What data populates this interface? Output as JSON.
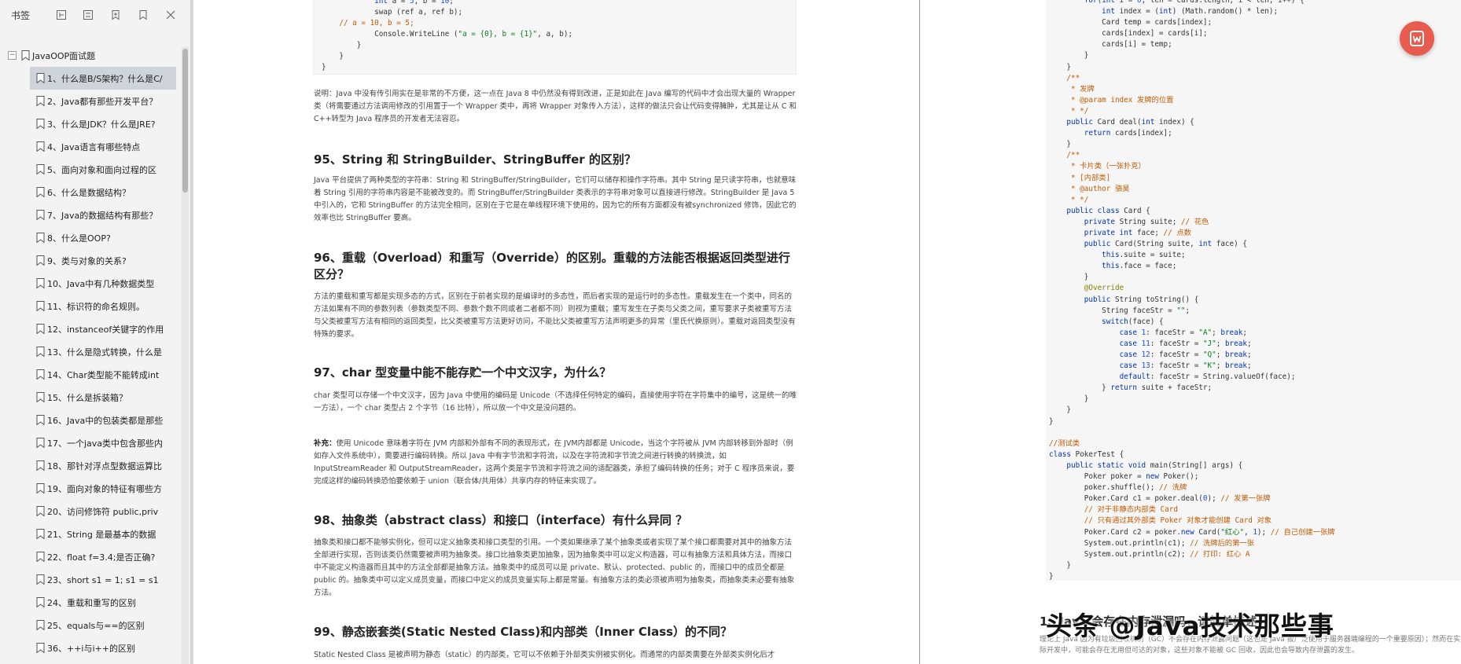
{
  "sidebar": {
    "title": "书签",
    "tools": [
      "expand-all-icon",
      "collapse-all-icon",
      "add-bookmark-icon",
      "bookmark-outline-icon",
      "close-icon"
    ],
    "root": {
      "toggle": "−",
      "label": "JavaOOP面试题"
    },
    "items": [
      "1、什么是B/S架构？什么是C/",
      "2、Java都有那些开发平台？",
      "3、什么是JDK？什么是JRE?",
      "4、Java语言有哪些特点",
      "5、面向对象和面向过程的区",
      "6、什么是数据结构？",
      "7、Java的数据结构有那些？",
      "8、什么是OOP?",
      "9、类与对象的关系?",
      "10、Java中有几种数据类型",
      "11、标识符的命名规则。",
      "12、instanceof关键字的作用",
      "13、什么是隐式转换，什么是",
      "14、Char类型能不能转成int",
      "15、什么是拆装箱？",
      "16、Java中的包装类都是那些",
      "17、一个java类中包含那些内",
      "18、那针对浮点型数据运算比",
      "19、面向对象的特征有哪些方",
      "20、访问修饰符 public,priv",
      "21、String 是最基本的数据",
      "22、float f=3.4;是否正确?",
      "23、short s1 = 1; s1 = s1",
      "24、重载和重写的区别",
      "25、equals与==的区别",
      "36、++i与i++的区别"
    ]
  },
  "page1": {
    "code_lines": [
      [
        "            ",
        "kw:int",
        " a = ",
        "num:5",
        ", b = ",
        "num:10",
        ";"
      ],
      [
        "            swap (ref a, ref b);"
      ],
      [
        "cm:    // a = 10, b = 5;"
      ],
      [
        "            Console.WriteLine (",
        "str:\"a = {0}, b = {1}\"",
        ", a, b);"
      ],
      [
        "        }"
      ],
      [
        "    }"
      ],
      [
        "}"
      ]
    ],
    "note": "说明：Java 中没有传引用实在是非常的不方便，这一点在 Java 8 中仍然没有得到改进，正是如此在 Java 编写的代码中才会出现大量的 Wrapper 类（将需要通过方法调用修改的引用置于一个 Wrapper 类中，再将 Wrapper 对象传入方法），这样的做法只会让代码变得臃肿，尤其是让从 C 和 C++转型为 Java 程序员的开发者无法容忍。",
    "h95": "95、String 和 StringBuilder、StringBuffer 的区别？",
    "p95": "Java 平台提供了两种类型的字符串：String 和 StringBuffer/StringBuilder，它们可以储存和操作字符串。其中 String 是只读字符串，也就意味着 String 引用的字符串内容是不能被改变的。而 StringBuffer/StringBuilder 类表示的字符串对象可以直接进行修改。StringBuilder 是 Java 5 中引入的，它和 StringBuffer 的方法完全相同，区别在于它是在单线程环境下使用的，因为它的所有方面都没有被synchronized 修饰，因此它的效率也比 StringBuffer 要高。",
    "h96": "96、重载（Overload）和重写（Override）的区别。重载的方法能否根据返回类型进行区分？",
    "p96": "方法的重载和重写都是实现多态的方式，区别在于前者实现的是编译时的多态性，而后者实现的是运行时的多态性。重载发生在一个类中，同名的方法如果有不同的参数列表（参数类型不同、参数个数不同或者二者都不同）则视为重载；重写发生在子类与父类之间，重写要求子类被重写方法与父类被重写方法有相同的返回类型，比父类被重写方法更好访问，不能比父类被重写方法声明更多的异常（里氏代换原则）。重载对返回类型没有特殊的要求。",
    "h97": "97、char 型变量中能不能存贮一个中文汉字，为什么？",
    "p97": "char 类型可以存储一个中文汉字，因为 Java 中使用的编码是 Unicode（不选择任何特定的编码，直接使用字符在字符集中的编号，这是统一的唯一方法），一个 char 类型占 2 个字节（16 比特），所以放一个中文是没问题的。",
    "p97b_label": "补充：",
    "p97b": "使用 Unicode 意味着字符在 JVM 内部和外部有不同的表现形式，在 JVM内部都是 Unicode，当这个字符被从 JVM 内部转移到外部时（例如存入文件系统中），需要进行编码转换。所以 Java 中有字节流和字符流，以及在字符流和字节流之间进行转换的转换流，如 InputStreamReader 和 OutputStreamReader，这两个类是字节流和字符流之间的适配器类，承担了编码转换的任务；对于 C 程序员来说，要完成这样的编码转换恐怕要依赖于 union（联合体/共用体）共享内存的特征来实现了。",
    "h98": "98、抽象类（abstract class）和接口（interface）有什么异同 ？",
    "p98": "抽象类和接口都不能够实例化，但可以定义抽象类和接口类型的引用。一个类如果继承了某个抽象类或者实现了某个接口都需要对其中的抽象方法全部进行实现，否则该类仍然需要被声明为抽象类。接口比抽象类更加抽象，因为抽象类中可以定义构造器，可以有抽象方法和具体方法，而接口中不能定义构造器而且其中的方法全部都是抽象方法。抽象类中的成员可以是 private、默认、protected、public 的，而接口中的成员全都是 public 的。抽象类中可以定义成员变量，而接口中定义的成员变量实际上都是常量。有抽象方法的类必须被声明为抽象类，而抽象类未必要有抽象方法。",
    "h99": "99、静态嵌套类(Static Nested Class)和内部类（Inner Class）的不同？",
    "p99": "Static Nested Class 是被声明为静态（static）的内部类，它可以不依赖于外部类实例被实例化。而通常的内部类需要在外部类实例化后才"
  },
  "page2": {
    "code_lines": [
      [
        "        ",
        "kw:for",
        "(",
        "kw:int",
        " i = ",
        "num:0",
        ", len = cards.length; i < len; i++) {"
      ],
      [
        "            ",
        "kw:int",
        " index = (",
        "kw:int",
        ") (Math.random() * len);"
      ],
      [
        "            Card temp = cards[index];"
      ],
      [
        "            cards[index] = cards[i];"
      ],
      [
        "            cards[i] = temp;"
      ],
      [
        "        }"
      ],
      [
        "    }"
      ],
      [
        "cm:    /**"
      ],
      [
        "cm:     * 发牌"
      ],
      [
        "cm:     * @param index 发牌的位置"
      ],
      [
        "cm:     * */"
      ],
      [
        "    ",
        "kw:public",
        " Card deal(",
        "kw:int",
        " index) {"
      ],
      [
        "        ",
        "kw:return",
        " cards[index];"
      ],
      [
        "    }"
      ],
      [
        "cm:    /**"
      ],
      [
        "cm:     * 卡片类（一张扑克）"
      ],
      [
        "cm:     * [内部类]"
      ],
      [
        "cm:     * @author 骆昊"
      ],
      [
        "cm:     * */"
      ],
      [
        "    ",
        "kw:public class",
        " Card {"
      ],
      [
        "        ",
        "kw:private",
        " String suite; ",
        "cm:// 花色"
      ],
      [
        "        ",
        "kw:private int",
        " face; ",
        "cm:// 点数"
      ],
      [
        "        ",
        "kw:public",
        " Card(String suite, ",
        "kw:int",
        " face) {"
      ],
      [
        "            ",
        "kw:this",
        ".suite = suite;"
      ],
      [
        "            ",
        "kw:this",
        ".face = face;"
      ],
      [
        "        }"
      ],
      [
        "        ",
        "ann:@Override"
      ],
      [
        "        ",
        "kw:public",
        " String toString() {"
      ],
      [
        "            String faceStr = ",
        "str:\"\"",
        ";"
      ],
      [
        "            ",
        "kw:switch",
        "(face) {"
      ],
      [
        "                ",
        "kw:case",
        " ",
        "num:1",
        ": faceStr = ",
        "str:\"A\"",
        "; ",
        "kw:break",
        ";"
      ],
      [
        "                ",
        "kw:case",
        " ",
        "num:11",
        ": faceStr = ",
        "str:\"J\"",
        "; ",
        "kw:break",
        ";"
      ],
      [
        "                ",
        "kw:case",
        " ",
        "num:12",
        ": faceStr = ",
        "str:\"Q\"",
        "; ",
        "kw:break",
        ";"
      ],
      [
        "                ",
        "kw:case",
        " ",
        "num:13",
        ": faceStr = ",
        "str:\"K\"",
        "; ",
        "kw:break",
        ";"
      ],
      [
        "                ",
        "kw:default",
        ": faceStr = String.valueOf(face);"
      ],
      [
        "            } ",
        "kw:return",
        " suite + faceStr;"
      ],
      [
        "        }"
      ],
      [
        "    }"
      ],
      [
        "}"
      ],
      [
        ""
      ],
      [
        "cm://测试类"
      ],
      [
        "kw:class",
        " PokerTest {"
      ],
      [
        "    ",
        "kw:public static void",
        " main(String[] args) {"
      ],
      [
        "        Poker poker = ",
        "kw:new",
        " Poker();"
      ],
      [
        "        poker.shuffle(); ",
        "cm:// 洗牌"
      ],
      [
        "        Poker.Card c1 = poker.deal(",
        "num:0",
        "); ",
        "cm:// 发第一张牌"
      ],
      [
        "cm:        // 对于非静态内部类 Card"
      ],
      [
        "cm:        // 只有通过其外部类 Poker 对象才能创建 Card 对象"
      ],
      [
        "        Poker.Card c2 = poker.",
        "kw:new",
        " Card(",
        "str:\"红心\"",
        ", ",
        "num:1",
        "); ",
        "cm:// 自己创建一张牌"
      ],
      [
        "        System.out.println(c1); ",
        "cm:// 洗牌后的第一张"
      ],
      [
        "        System.out.println(c2); ",
        "cm:// 打印: 红心 A"
      ],
      [
        "    }"
      ],
      [
        "}"
      ]
    ],
    "bottom_heading": "1、Java 会存在内存泄漏吗，请简单描述",
    "bottom_text": "理论上 Java 因为有垃圾回收机制（GC）不会存在内存泄露问题（这也是 Java 被广泛使用于服务器端编程的一个重要原因）；然而在实际开发中，可能会存在无用但可达的对象，这些对象不能被 GC 回收，因此也会导致内存泄露的发生。",
    "watermark": "头条 @Java技术那些事"
  },
  "float_button": {
    "icon": "office-app-icon"
  }
}
